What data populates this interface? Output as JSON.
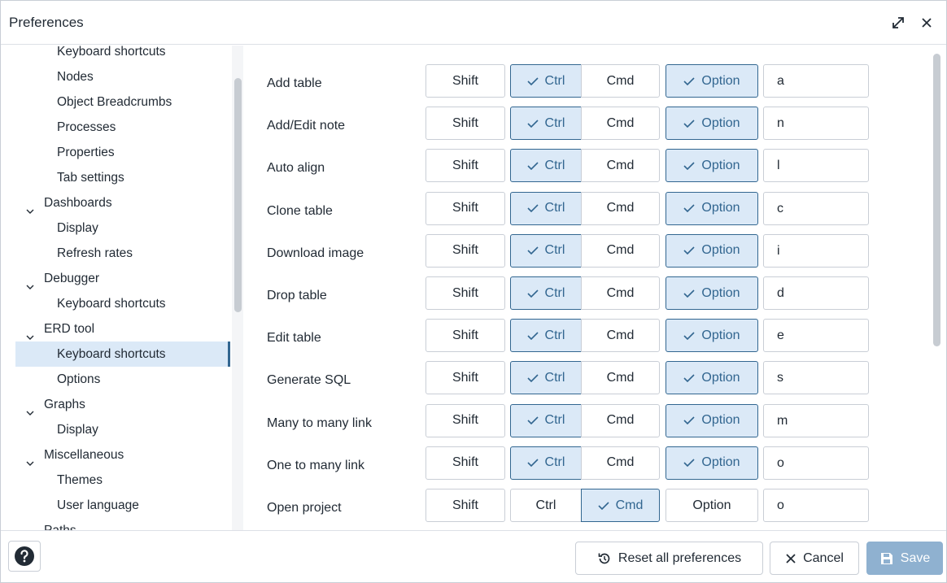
{
  "dialog": {
    "title": "Preferences"
  },
  "sidebar": {
    "items": [
      {
        "label": "Keyboard shortcuts",
        "kind": "child"
      },
      {
        "label": "Nodes",
        "kind": "child"
      },
      {
        "label": "Object Breadcrumbs",
        "kind": "child"
      },
      {
        "label": "Processes",
        "kind": "child"
      },
      {
        "label": "Properties",
        "kind": "child"
      },
      {
        "label": "Tab settings",
        "kind": "child"
      },
      {
        "label": "Dashboards",
        "kind": "parent"
      },
      {
        "label": "Display",
        "kind": "child"
      },
      {
        "label": "Refresh rates",
        "kind": "child"
      },
      {
        "label": "Debugger",
        "kind": "parent"
      },
      {
        "label": "Keyboard shortcuts",
        "kind": "child"
      },
      {
        "label": "ERD tool",
        "kind": "parent"
      },
      {
        "label": "Keyboard shortcuts",
        "kind": "child",
        "selected": true
      },
      {
        "label": "Options",
        "kind": "child"
      },
      {
        "label": "Graphs",
        "kind": "parent"
      },
      {
        "label": "Display",
        "kind": "child"
      },
      {
        "label": "Miscellaneous",
        "kind": "parent"
      },
      {
        "label": "Themes",
        "kind": "child"
      },
      {
        "label": "User language",
        "kind": "child"
      },
      {
        "label": "Paths",
        "kind": "parent"
      }
    ]
  },
  "modifiers": {
    "shift": "Shift",
    "ctrl": "Ctrl",
    "cmd": "Cmd",
    "option": "Option"
  },
  "shortcuts": [
    {
      "label": "Add table",
      "shift": false,
      "ctrl": true,
      "cmd": false,
      "option": true,
      "key": "a"
    },
    {
      "label": "Add/Edit note",
      "shift": false,
      "ctrl": true,
      "cmd": false,
      "option": true,
      "key": "n"
    },
    {
      "label": "Auto align",
      "shift": false,
      "ctrl": true,
      "cmd": false,
      "option": true,
      "key": "l"
    },
    {
      "label": "Clone table",
      "shift": false,
      "ctrl": true,
      "cmd": false,
      "option": true,
      "key": "c"
    },
    {
      "label": "Download image",
      "shift": false,
      "ctrl": true,
      "cmd": false,
      "option": true,
      "key": "i"
    },
    {
      "label": "Drop table",
      "shift": false,
      "ctrl": true,
      "cmd": false,
      "option": true,
      "key": "d"
    },
    {
      "label": "Edit table",
      "shift": false,
      "ctrl": true,
      "cmd": false,
      "option": true,
      "key": "e"
    },
    {
      "label": "Generate SQL",
      "shift": false,
      "ctrl": true,
      "cmd": false,
      "option": true,
      "key": "s"
    },
    {
      "label": "Many to many link",
      "shift": false,
      "ctrl": true,
      "cmd": false,
      "option": true,
      "key": "m"
    },
    {
      "label": "One to many link",
      "shift": false,
      "ctrl": true,
      "cmd": false,
      "option": true,
      "key": "o"
    },
    {
      "label": "Open project",
      "shift": false,
      "ctrl": false,
      "cmd": true,
      "option": false,
      "key": "o"
    }
  ],
  "footer": {
    "reset_label": "Reset all preferences",
    "cancel_label": "Cancel",
    "save_label": "Save"
  },
  "colors": {
    "accent": "#326690",
    "checked_bg": "#dbe9f7",
    "save_disabled": "#8fb1d0"
  }
}
